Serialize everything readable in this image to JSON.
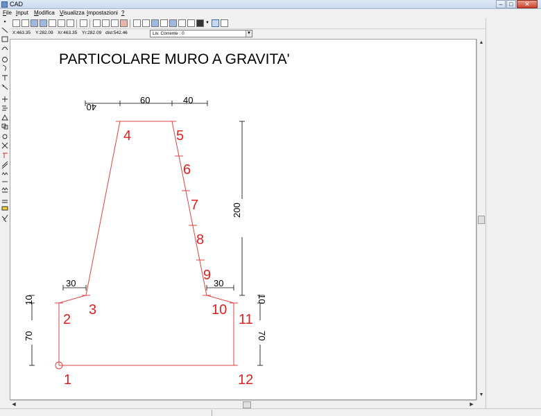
{
  "window": {
    "title": "CAD"
  },
  "menu": [
    {
      "label": "File",
      "u": "F",
      "rest": "ile"
    },
    {
      "label": "Input",
      "u": "I",
      "rest": "nput"
    },
    {
      "label": "Modifica",
      "u": "M",
      "rest": "odifica"
    },
    {
      "label": "Visualizza",
      "u": "V",
      "rest": "isualizza"
    },
    {
      "label": "Impostazioni",
      "u": "I",
      "rest": "mpostazioni"
    },
    {
      "label": "?",
      "u": "?",
      "rest": ""
    }
  ],
  "status": {
    "x": "X:463.35",
    "y": "Y:282.09",
    "xr": "Xr:463.35",
    "yr": "Yr:282.09",
    "dist": "dist:542.46",
    "layer": "Liv. Corrente : 0"
  },
  "drawing": {
    "title": "PARTICOLARE MURO A GRAVITA'",
    "point_labels": [
      "1",
      "2",
      "3",
      "4",
      "5",
      "6",
      "7",
      "8",
      "9",
      "10",
      "11",
      "12"
    ],
    "dimensions": {
      "top_left_offset": "40",
      "top_width": "60",
      "top_right_offset": "40",
      "height": "200",
      "left_step": "30",
      "right_step": "30",
      "left_top_small": "10",
      "left_base_height": "70",
      "right_top_small": "10",
      "right_base_height": "70"
    },
    "colors": {
      "profile": "#e04040",
      "labels": "#e02020",
      "dimension": "#000000"
    }
  },
  "icons": {
    "window_minimize": "–",
    "window_maximize": "□",
    "window_close": "✕",
    "scroll_up": "▲",
    "scroll_down": "▼",
    "scroll_left": "◀",
    "scroll_right": "▶",
    "combo_down": "▼"
  }
}
